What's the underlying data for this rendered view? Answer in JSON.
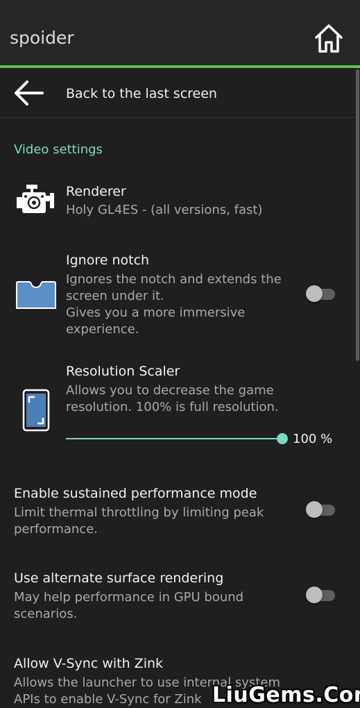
{
  "app": {
    "title": "spoider"
  },
  "nav": {
    "back_label": "Back to the last screen"
  },
  "section": {
    "title": "Video settings"
  },
  "prefs": {
    "renderer": {
      "title": "Renderer",
      "summary": "Holy GL4ES - (all versions, fast)"
    },
    "ignore_notch": {
      "title": "Ignore notch",
      "summary_lines": [
        "Ignores the notch and extends the",
        "screen under it.",
        "Gives you a more immersive",
        "experience."
      ],
      "enabled": false
    },
    "resolution_scaler": {
      "title": "Resolution Scaler",
      "summary_lines": [
        "Allows you to decrease the game",
        "resolution. 100% is full resolution."
      ],
      "value_percent": 100,
      "value_label": "100 %"
    },
    "sustained_performance": {
      "title": "Enable sustained performance mode",
      "summary_lines": [
        "Limit thermal throttling by limiting peak",
        "performance."
      ],
      "enabled": false
    },
    "alternate_surface": {
      "title": "Use alternate surface rendering",
      "summary_lines": [
        "May help performance in GPU bound",
        "scenarios."
      ],
      "enabled": false
    },
    "vsync_zink": {
      "title": "Allow V-Sync with Zink",
      "summary_lines": [
        "Allows the launcher to use internal system",
        "APIs to enable V-Sync for Zink"
      ]
    }
  },
  "watermark": "LiuGems.Com",
  "colors": {
    "accent": "#7fd8c4",
    "toolbar_line": "#5cc24a",
    "background": "#1f1f1f"
  },
  "icons": {
    "home": "home-icon",
    "back": "arrow-left-icon",
    "renderer": "engine-icon",
    "notch": "notch-phone-icon",
    "scaler": "phone-resize-icon"
  }
}
